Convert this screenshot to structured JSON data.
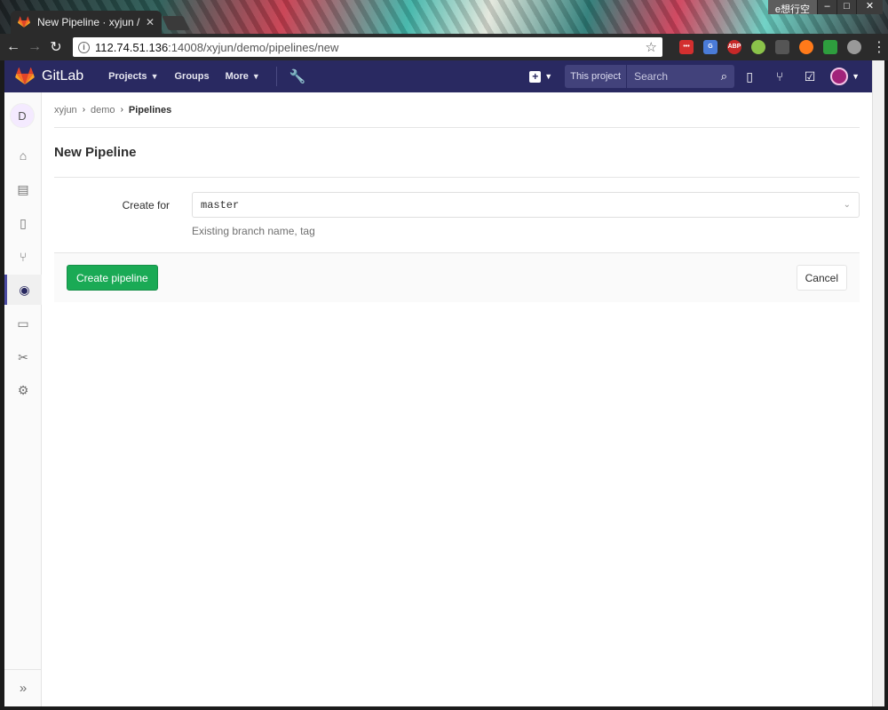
{
  "browser": {
    "tab_title": "New Pipeline · xyjun / d",
    "tab_close": "✕",
    "user_badge": "e想行空",
    "url_host": "112.74.51.136",
    "url_rest": ":14008/xyjun/demo/pipelines/new",
    "ext_abp": "ABP"
  },
  "header": {
    "brand": "GitLab",
    "nav": [
      {
        "label": "Projects"
      },
      {
        "label": "Groups"
      },
      {
        "label": "More"
      }
    ],
    "scope_label": "This project",
    "search_placeholder": "Search"
  },
  "sidebar": {
    "project_initial": "D",
    "active_item": "pipelines"
  },
  "breadcrumb": {
    "items": [
      "xyjun",
      "demo",
      "Pipelines"
    ]
  },
  "main": {
    "title": "New Pipeline",
    "create_for_label": "Create for",
    "ref_value": "master",
    "ref_help": "Existing branch name, tag",
    "create_button": "Create pipeline",
    "cancel_button": "Cancel"
  },
  "colors": {
    "header_bg": "#292961",
    "primary_green": "#1aaa55",
    "sidebar_active": "#4b4ba3"
  }
}
